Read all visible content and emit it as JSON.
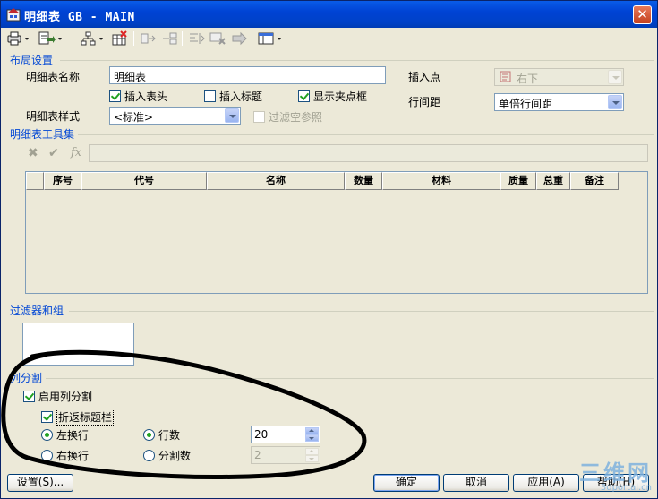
{
  "window": {
    "title": "明细表 GB - MAIN",
    "close_glyph": "✕"
  },
  "toolbar": {
    "icons": [
      "print-icon",
      "export-icon",
      "tree-icon",
      "delete-table-icon",
      "split-icon",
      "merge-icon",
      "align-icon",
      "delete-row-icon",
      "move-icon",
      "view-icon"
    ]
  },
  "layout": {
    "section_title": "布局设置",
    "name_label": "明细表名称",
    "name_value": "明细表",
    "insert_point_label": "插入点",
    "insert_point_value": "右下",
    "insert_header_label": "插入表头",
    "insert_header_checked": true,
    "insert_title_label": "插入标题",
    "insert_title_checked": false,
    "show_grips_label": "显示夹点框",
    "show_grips_checked": true,
    "line_spacing_label": "行间距",
    "line_spacing_value": "单倍行间距",
    "style_label": "明细表样式",
    "style_value": "<标准>",
    "filter_empty_label": "过滤空参照",
    "filter_empty_checked": false
  },
  "tools": {
    "section_title": "明细表工具集",
    "cancel_glyph": "✖",
    "confirm_glyph": "✔",
    "fx_glyph": "fx"
  },
  "grid": {
    "columns": [
      "",
      "序号",
      "代号",
      "名称",
      "数量",
      "材料",
      "质量",
      "总重",
      "备注"
    ]
  },
  "filter": {
    "section_title": "过滤器和组"
  },
  "split": {
    "section_title": "列分割",
    "enable_label": "启用列分割",
    "enable_checked": true,
    "fold_title_label": "折返标题栏",
    "fold_title_checked": true,
    "left_wrap_label": "左换行",
    "right_wrap_label": "右换行",
    "rows_label": "行数",
    "rows_value": "20",
    "parts_label": "分割数",
    "parts_value": "2",
    "wrap_selected": "left",
    "mode_selected": "rows"
  },
  "buttons": {
    "settings": "设置(S)...",
    "ok": "确定",
    "cancel": "取消",
    "apply": "应用(A)",
    "help": "帮助(H)"
  },
  "watermark": {
    "big": "三维网",
    "small": "3dportal.cn"
  },
  "colors": {
    "titlebar": "#0a5ce8",
    "section_title": "#0046d5",
    "dialog_bg": "#ece9d8",
    "annotation": "#000000"
  }
}
